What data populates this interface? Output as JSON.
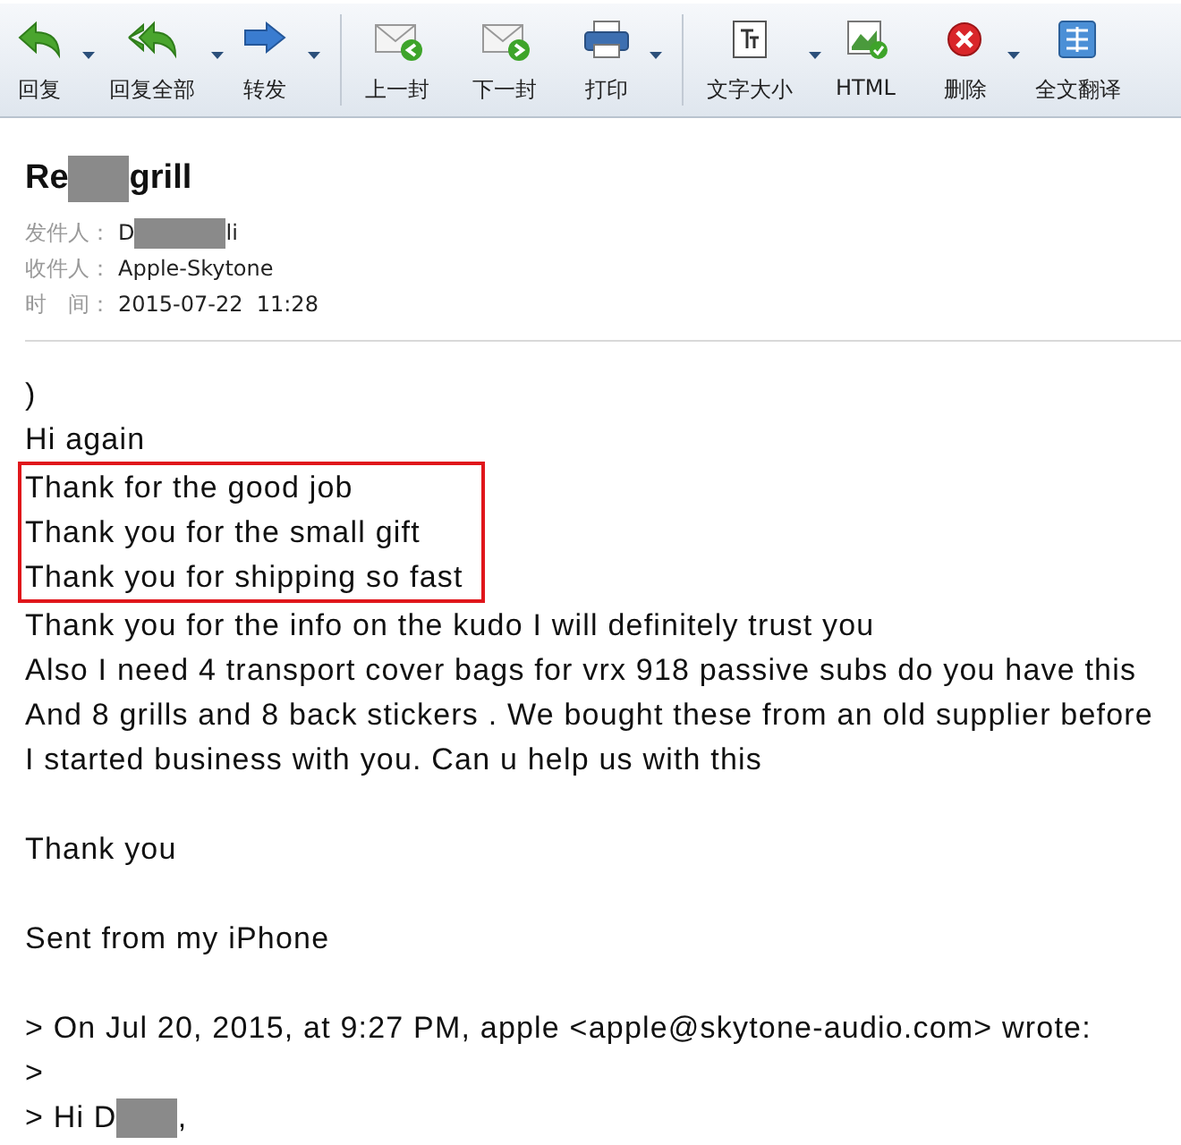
{
  "toolbar": [
    {
      "kind": "reply",
      "label": "回复",
      "dropdown": true
    },
    {
      "kind": "reply-all",
      "label": "回复全部",
      "dropdown": true
    },
    {
      "kind": "forward",
      "label": "转发",
      "dropdown": true
    },
    {
      "kind": "separator"
    },
    {
      "kind": "previous",
      "label": "上一封",
      "dropdown": false
    },
    {
      "kind": "next",
      "label": "下一封",
      "dropdown": false
    },
    {
      "kind": "print",
      "label": "打印",
      "dropdown": true
    },
    {
      "kind": "separator"
    },
    {
      "kind": "text-size",
      "label": "文字大小",
      "dropdown": true
    },
    {
      "kind": "html",
      "label": "HTML",
      "dropdown": false
    },
    {
      "kind": "delete",
      "label": "删除",
      "dropdown": true
    },
    {
      "kind": "translate",
      "label": "全文翻译",
      "dropdown": false
    }
  ],
  "subject": [
    {
      "kind": "text",
      "text": "Re"
    },
    {
      "kind": "redacted"
    },
    {
      "kind": "text",
      "text": "grill"
    }
  ],
  "meta": [
    {
      "label": "发件人：",
      "value": [
        {
          "kind": "text",
          "text": "D"
        },
        {
          "kind": "redacted"
        },
        {
          "kind": "text",
          "text": "li"
        }
      ]
    },
    {
      "label": "收件人：",
      "value": [
        {
          "kind": "text",
          "text": "Apple-Skytone"
        }
      ]
    },
    {
      "label": "时　间：",
      "value": [
        {
          "kind": "text",
          "text": "2015-07-22  11:28"
        }
      ]
    }
  ],
  "body": [
    {
      "text": [
        {
          "kind": "text",
          "text": ")"
        }
      ],
      "highlighted": false
    },
    {
      "text": [
        {
          "kind": "text",
          "text": "Hi again"
        }
      ],
      "highlighted": false
    },
    {
      "text": [
        {
          "kind": "text",
          "text": "Thank for the good job"
        }
      ],
      "highlighted": true
    },
    {
      "text": [
        {
          "kind": "text",
          "text": "Thank you for the small gift"
        }
      ],
      "highlighted": true
    },
    {
      "text": [
        {
          "kind": "text",
          "text": "Thank you for shipping so fast"
        }
      ],
      "highlighted": true
    },
    {
      "text": [
        {
          "kind": "text",
          "text": "Thank you for the info on the kudo I will definitely trust you"
        }
      ],
      "highlighted": false
    },
    {
      "text": [
        {
          "kind": "text",
          "text": "Also I need 4 transport cover bags for vrx 918 passive subs do you have this"
        }
      ],
      "highlighted": false
    },
    {
      "text": [
        {
          "kind": "text",
          "text": "And 8 grills and 8 back stickers . We bought these from an old supplier before"
        }
      ],
      "highlighted": false
    },
    {
      "text": [
        {
          "kind": "text",
          "text": "I started business with you. Can u help us with this"
        }
      ],
      "highlighted": false
    },
    {
      "kind": "blank"
    },
    {
      "text": [
        {
          "kind": "text",
          "text": "Thank you"
        }
      ],
      "highlighted": false
    },
    {
      "kind": "blank"
    },
    {
      "text": [
        {
          "kind": "text",
          "text": "Sent from my iPhone"
        }
      ],
      "highlighted": false
    },
    {
      "kind": "blank"
    },
    {
      "text": [
        {
          "kind": "text",
          "text": "> On Jul 20, 2015, at 9:27 PM, apple <apple@skytone-audio.com> wrote:"
        }
      ],
      "highlighted": false
    },
    {
      "text": [
        {
          "kind": "text",
          "text": ">"
        }
      ],
      "highlighted": false
    },
    {
      "text": [
        {
          "kind": "text",
          "text": "> Hi D"
        },
        {
          "kind": "redacted"
        },
        {
          "kind": "text",
          "text": ","
        }
      ],
      "highlighted": false
    }
  ]
}
